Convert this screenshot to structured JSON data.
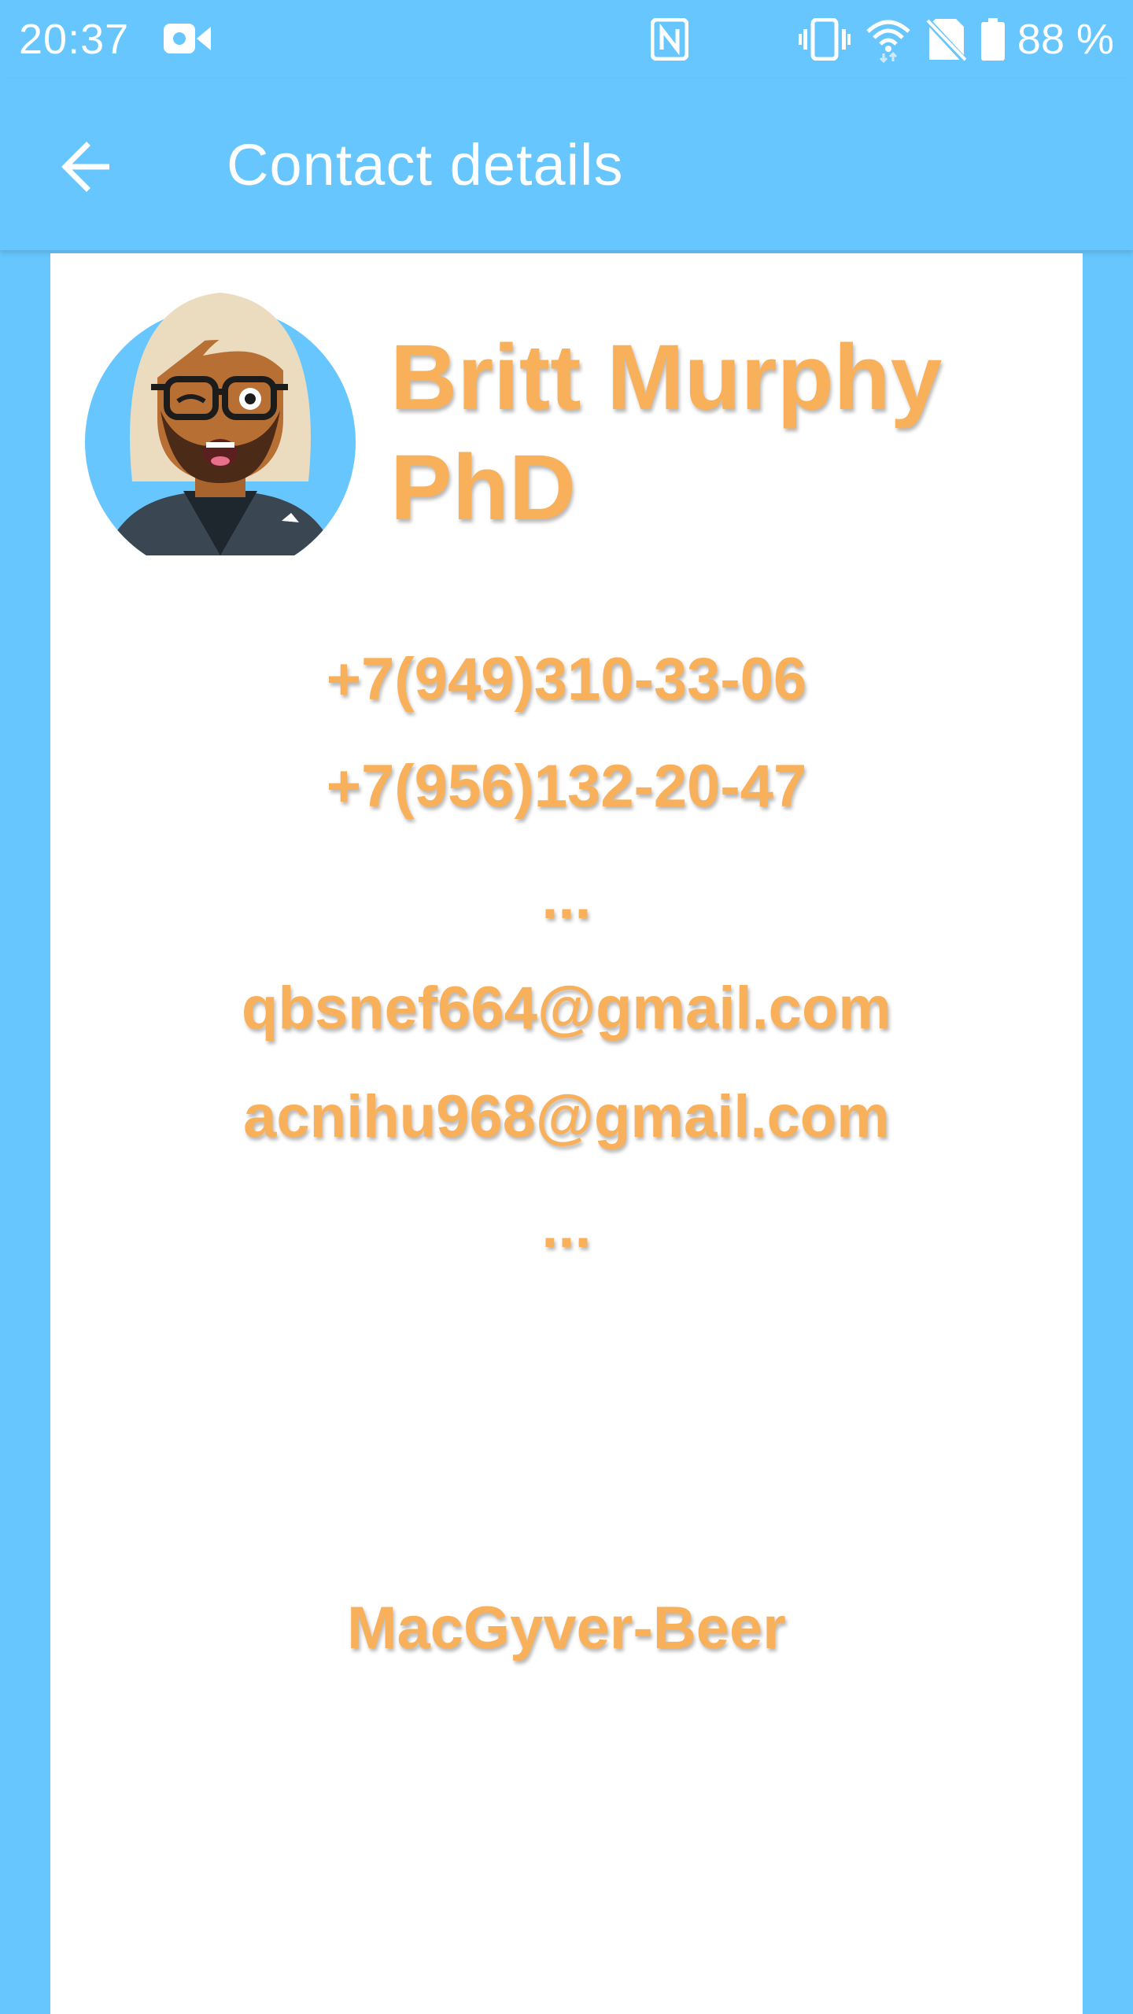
{
  "status_bar": {
    "time": "20:37",
    "battery": "88 %",
    "icons": [
      "video-camera-icon",
      "nfc-icon",
      "vibrate-icon",
      "wifi-icon",
      "no-sim-icon",
      "battery-icon"
    ]
  },
  "app_bar": {
    "title": "Contact details",
    "back_icon": "arrow-left-icon"
  },
  "contact": {
    "name": "Britt Murphy PhD",
    "phones": [
      "+7(949)310-33-06",
      "+7(956)132-20-47"
    ],
    "phones_more": "...",
    "emails": [
      "qbsnef664@gmail.com",
      "acnihu968@gmail.com"
    ],
    "emails_more": "...",
    "company": "MacGyver-Beer"
  },
  "colors": {
    "primary": "#66c6fd",
    "accent_text": "#f8b05a",
    "card": "#ffffff"
  }
}
